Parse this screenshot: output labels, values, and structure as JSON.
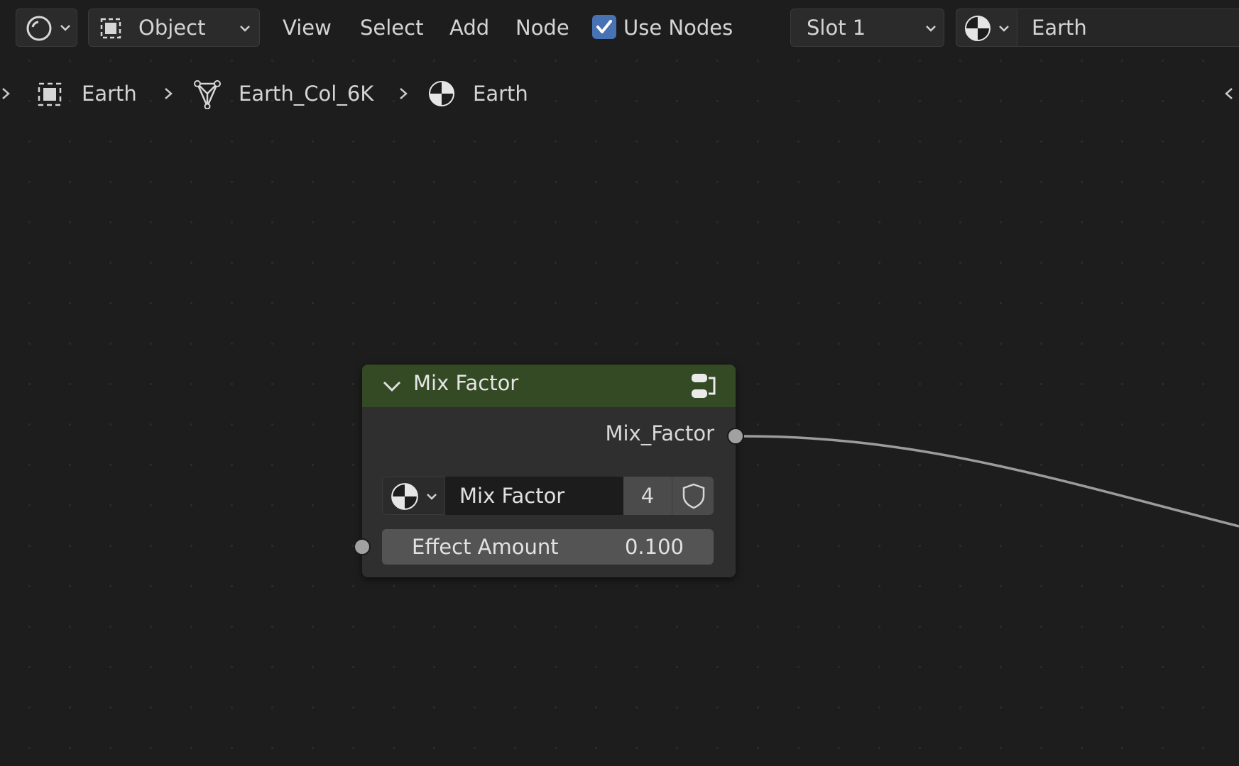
{
  "header": {
    "editor_type_icon": "node-editor-icon",
    "mode_label": "Object",
    "menu": [
      "View",
      "Select",
      "Add",
      "Node"
    ],
    "use_nodes_label": "Use Nodes",
    "use_nodes_checked": true,
    "slot_label": "Slot 1",
    "material_name": "Earth"
  },
  "breadcrumb": {
    "items": [
      {
        "icon": "object-icon",
        "label": "Earth"
      },
      {
        "icon": "mesh-icon",
        "label": "Earth_Col_6K"
      },
      {
        "icon": "material-icon",
        "label": "Earth"
      }
    ]
  },
  "node": {
    "title": "Mix Factor",
    "output_socket_label": "Mix_Factor",
    "datablock_name": "Mix Factor",
    "user_count": "4",
    "input_label": "Effect Amount",
    "input_value": "0.100"
  },
  "colors": {
    "node_header": "#344a24",
    "accent": "#4772b3"
  }
}
